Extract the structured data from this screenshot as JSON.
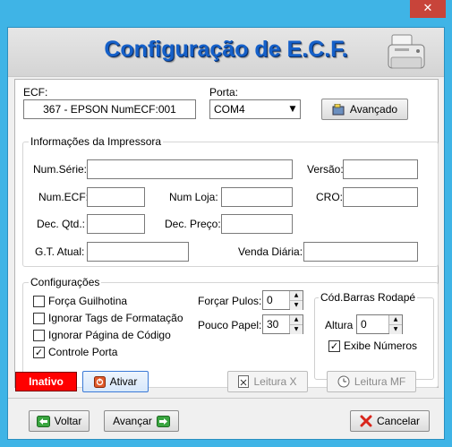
{
  "window": {
    "close_glyph": "✕"
  },
  "header": {
    "title": "Configuração de E.C.F.",
    "icon": "printer-icon"
  },
  "ecf": {
    "label": "ECF:",
    "value": "367 - EPSON NumECF:001",
    "porta_label": "Porta:",
    "porta_value": "COM4",
    "advanced_label": "Avançado"
  },
  "info": {
    "title": "Informações da Impressora",
    "num_serie_label": "Num.Série:",
    "num_serie_value": "",
    "versao_label": "Versão:",
    "versao_value": "",
    "num_ecf_label": "Num.ECF:",
    "num_ecf_value": "",
    "num_loja_label": "Num Loja:",
    "num_loja_value": "",
    "cro_label": "CRO:",
    "cro_value": "",
    "dec_qtd_label": "Dec. Qtd.:",
    "dec_qtd_value": "",
    "dec_preco_label": "Dec. Preço:",
    "dec_preco_value": "",
    "gt_label": "G.T. Atual:",
    "gt_value": "",
    "venda_label": "Venda Diária:",
    "venda_value": ""
  },
  "config": {
    "title": "Configurações",
    "checks": [
      {
        "label": "Força Guilhotina",
        "checked": false
      },
      {
        "label": "Ignorar Tags de Formatação",
        "checked": false
      },
      {
        "label": "Ignorar Página de Código",
        "checked": false
      },
      {
        "label": "Controle Porta",
        "checked": true
      }
    ],
    "forcar_pulos_label": "Forçar Pulos:",
    "forcar_pulos_value": "0",
    "pouco_papel_label": "Pouco Papel:",
    "pouco_papel_value": "30",
    "barcode": {
      "title": "Cód.Barras Rodapé",
      "altura_label": "Altura",
      "altura_value": "0",
      "exibe_label": "Exibe Números",
      "exibe_checked": true
    }
  },
  "actions": {
    "status": "Inativo",
    "ativar_label": "Ativar",
    "leitura_x_label": "Leitura X",
    "leitura_mf_label": "Leitura MF"
  },
  "footer": {
    "voltar_label": "Voltar",
    "avancar_label": "Avançar",
    "cancelar_label": "Cancelar"
  },
  "colors": {
    "title_blue": "#1560c9",
    "status_red": "#ff0000",
    "frame_blue": "#3fb4e6"
  }
}
